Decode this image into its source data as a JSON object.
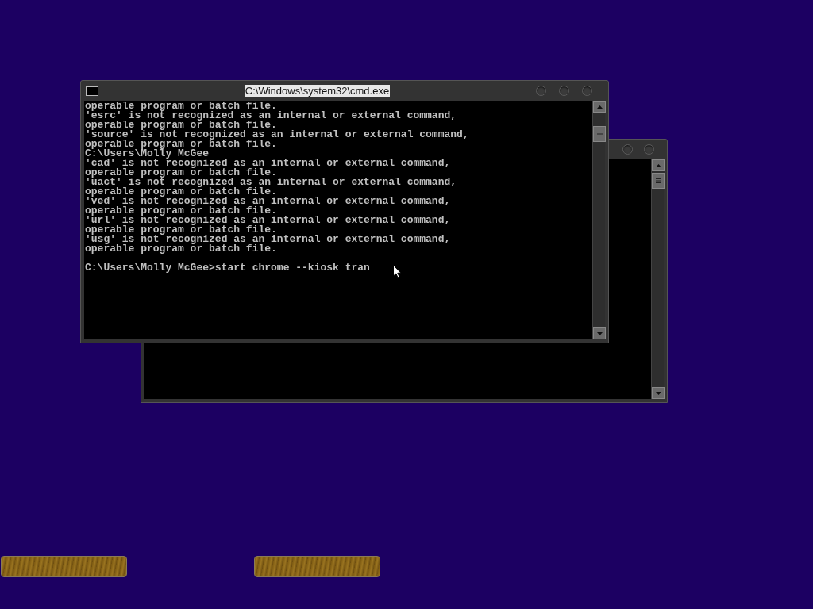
{
  "front_window": {
    "title": "C:\\Windows\\system32\\cmd.exe",
    "lines": [
      "operable program or batch file.",
      "'esrc' is not recognized as an internal or external command,",
      "operable program or batch file.",
      "'source' is not recognized as an internal or external command,",
      "operable program or batch file.",
      "C:\\Users\\Molly McGee",
      "'cad' is not recognized as an internal or external command,",
      "operable program or batch file.",
      "'uact' is not recognized as an internal or external command,",
      "operable program or batch file.",
      "'ved' is not recognized as an internal or external command,",
      "operable program or batch file.",
      "'url' is not recognized as an internal or external command,",
      "operable program or batch file.",
      "'usg' is not recognized as an internal or external command,",
      "operable program or batch file."
    ],
    "prompt": "C:\\Users\\Molly McGee>start chrome --kiosk tran"
  }
}
